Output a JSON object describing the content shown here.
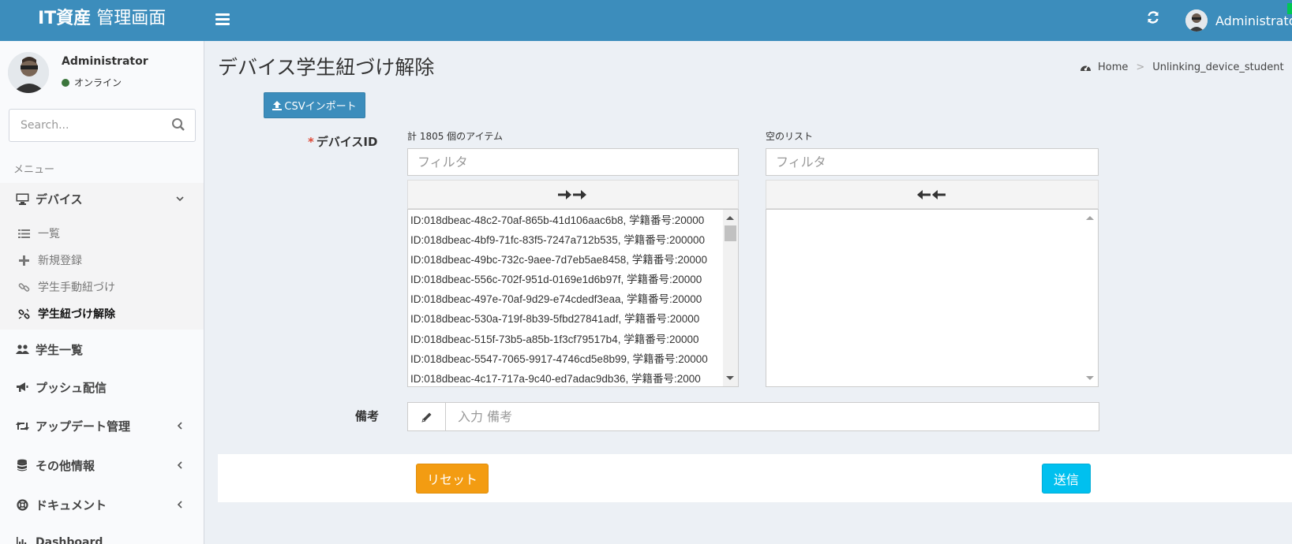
{
  "header": {
    "logo_bold": "IT資産",
    "logo_light": "管理画面",
    "user_name": "Administrator"
  },
  "sidebar": {
    "user_name": "Administrator",
    "status": "オンライン",
    "search_placeholder": "Search...",
    "menu_header": "メニュー",
    "items": [
      {
        "label": "デバイス",
        "icon": "desktop-icon",
        "expanded": true
      },
      {
        "label": "学生一覧",
        "icon": "users-icon"
      },
      {
        "label": "プッシュ配信",
        "icon": "bullhorn-icon"
      },
      {
        "label": "アップデート管理",
        "icon": "retweet-icon"
      },
      {
        "label": "その他情報",
        "icon": "database-icon"
      },
      {
        "label": "ドキュメント",
        "icon": "life-ring-icon"
      },
      {
        "label": "Dashboard",
        "icon": "bar-chart-icon"
      }
    ],
    "sub_items": [
      {
        "label": "一覧",
        "icon": "list-icon"
      },
      {
        "label": "新規登録",
        "icon": "plus-icon"
      },
      {
        "label": "学生手動紐づけ",
        "icon": "link-icon"
      },
      {
        "label": "学生紐づけ解除",
        "icon": "unlink-icon",
        "active": true
      }
    ]
  },
  "main": {
    "page_title": "デバイス学生紐づけ解除",
    "breadcrumb": {
      "home": "Home",
      "current": "Unlinking_device_student"
    },
    "csv_button": "CSVインポート",
    "device_label": "デバイスID",
    "remarks_label": "備考",
    "left_list": {
      "caption": "計 1805 個のアイテム",
      "filter_placeholder": "フィルタ",
      "items": [
        "ID:018dbeac-48c2-70af-865b-41d106aac6b8, 学籍番号:20000",
        "ID:018dbeac-4bf9-71fc-83f5-7247a712b535, 学籍番号:200000",
        "ID:018dbeac-49bc-732c-9aee-7d7eb5ae8458, 学籍番号:20000",
        "ID:018dbeac-556c-702f-951d-0169e1d6b97f, 学籍番号:20000",
        "ID:018dbeac-497e-70af-9d29-e74cdedf3eaa, 学籍番号:20000",
        "ID:018dbeac-530a-719f-8b39-5fbd27841adf, 学籍番号:20000",
        "ID:018dbeac-515f-73b5-a85b-1f3cf79517b4, 学籍番号:20000",
        "ID:018dbeac-5547-7065-9917-4746cd5e8b99, 学籍番号:20000",
        "ID:018dbeac-4c17-717a-9c40-ed7adac9db36, 学籍番号:2000"
      ]
    },
    "right_list": {
      "caption": "空のリスト",
      "filter_placeholder": "フィルタ"
    },
    "remarks_placeholder": "入力 備考",
    "reset_button": "リセット",
    "send_button": "送信"
  },
  "colors": {
    "header": "#3c8dbc",
    "reset": "#f39c12",
    "send": "#00c0ef",
    "required": "#dd4b39"
  }
}
